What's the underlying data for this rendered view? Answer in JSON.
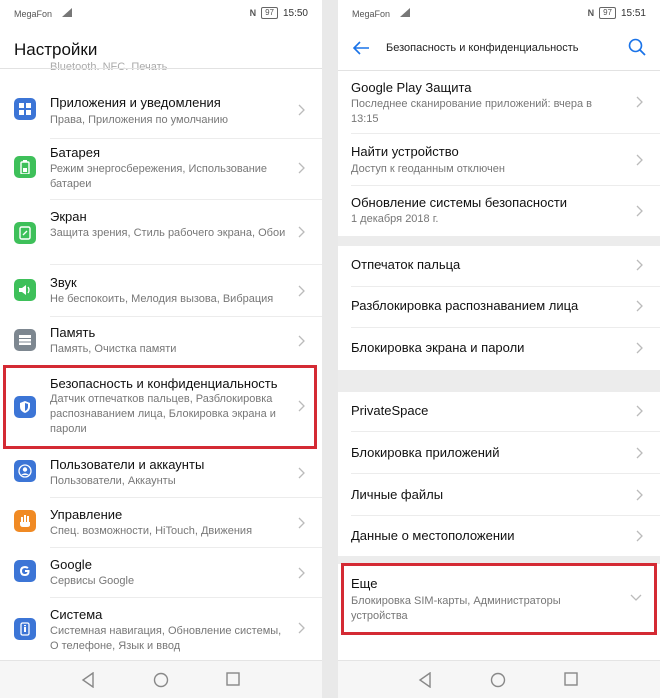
{
  "left": {
    "status": {
      "carrier": "MegaFon",
      "nfc": "N",
      "battery": "97",
      "time": "15:50"
    },
    "title": "Настройки",
    "cut_text": "Bluetooth, NFC, Печать",
    "items": [
      {
        "title": "Приложения и уведомления",
        "sub": "Права, Приложения по умолчанию",
        "icon_color": "#3c75d6"
      },
      {
        "title": "Батарея",
        "sub": "Режим энергосбережения, Использование батареи",
        "icon_color": "#3ec05a"
      },
      {
        "title": "Экран",
        "sub": "Защита зрения, Стиль рабочего экрана, Обои",
        "icon_color": "#3ec05a"
      },
      {
        "title": "Звук",
        "sub": "Не беспокоить, Мелодия вызова, Вибрация",
        "icon_color": "#3ec05a"
      },
      {
        "title": "Память",
        "sub": "Память, Очистка памяти",
        "icon_color": "#7d8790"
      },
      {
        "title": "Безопасность и конфиденциальность",
        "sub": "Датчик отпечатков пальцев, Разблокировка распознаванием лица, Блокировка экрана и пароли",
        "icon_color": "#3c75d6"
      },
      {
        "title": "Пользователи и аккаунты",
        "sub": "Пользователи, Аккаунты",
        "icon_color": "#3c75d6"
      },
      {
        "title": "Управление",
        "sub": "Спец. возможности, HiTouch, Движения",
        "icon_color": "#f08a24"
      },
      {
        "title": "Google",
        "sub": "Сервисы Google",
        "icon_color": "#3c75d6"
      },
      {
        "title": "Система",
        "sub": "Системная навигация, Обновление системы, О телефоне, Язык и ввод",
        "icon_color": "#3c75d6"
      }
    ]
  },
  "right": {
    "status": {
      "carrier": "MegaFon",
      "nfc": "N",
      "battery": "97",
      "time": "15:51"
    },
    "title": "Безопасность и конфиденциальность",
    "items": [
      {
        "title": "Google Play Защита",
        "sub": "Последнее сканирование приложений: вчера в 13:15"
      },
      {
        "title": "Найти устройство",
        "sub": "Доступ к геоданным отключен"
      },
      {
        "title": "Обновление системы безопасности",
        "sub": "1 декабря 2018 г."
      },
      {
        "title": "Отпечаток пальца"
      },
      {
        "title": "Разблокировка распознаванием лица"
      },
      {
        "title": "Блокировка экрана и пароли"
      },
      {
        "title": "PrivateSpace"
      },
      {
        "title": "Блокировка приложений"
      },
      {
        "title": "Личные файлы"
      },
      {
        "title": "Данные о местоположении"
      },
      {
        "title": "Еще",
        "sub": "Блокировка SIM-карты, Администраторы устройства"
      }
    ]
  },
  "colors": {
    "highlight": "#d42a34",
    "accent": "#1a73e8"
  }
}
